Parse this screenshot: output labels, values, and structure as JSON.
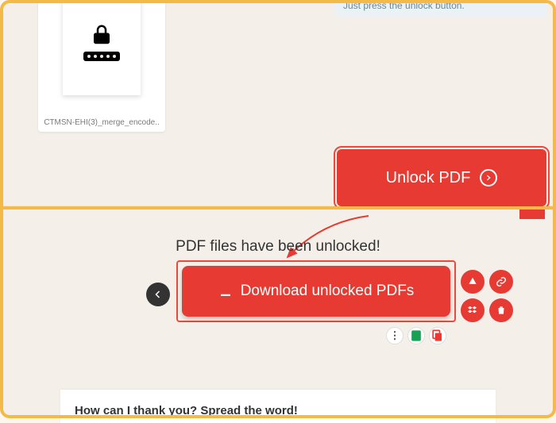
{
  "colors": {
    "accent_red": "#e63a32",
    "frame_orange": "#f5b947",
    "panel_bg": "#f4f0e9"
  },
  "top": {
    "info_text": "Just press the unlock button.",
    "file": {
      "caption": "CTMSN-EHI(3)_merge_encode.."
    },
    "unlock_label": "Unlock PDF"
  },
  "bottom": {
    "success_heading": "PDF files have been unlocked!",
    "download_label": "Download unlocked PDFs",
    "footer_prompt": "How can I thank you? Spread the word!"
  },
  "icons": {
    "lock": "lock-icon",
    "arrow_right": "arrow-right-icon",
    "download": "download-icon",
    "back": "back-icon",
    "drive": "google-drive-icon",
    "link": "link-icon",
    "dropbox": "dropbox-icon",
    "trash": "trash-icon",
    "more": "more-icon",
    "sheet": "sheet-icon",
    "copy": "copy-icon"
  }
}
